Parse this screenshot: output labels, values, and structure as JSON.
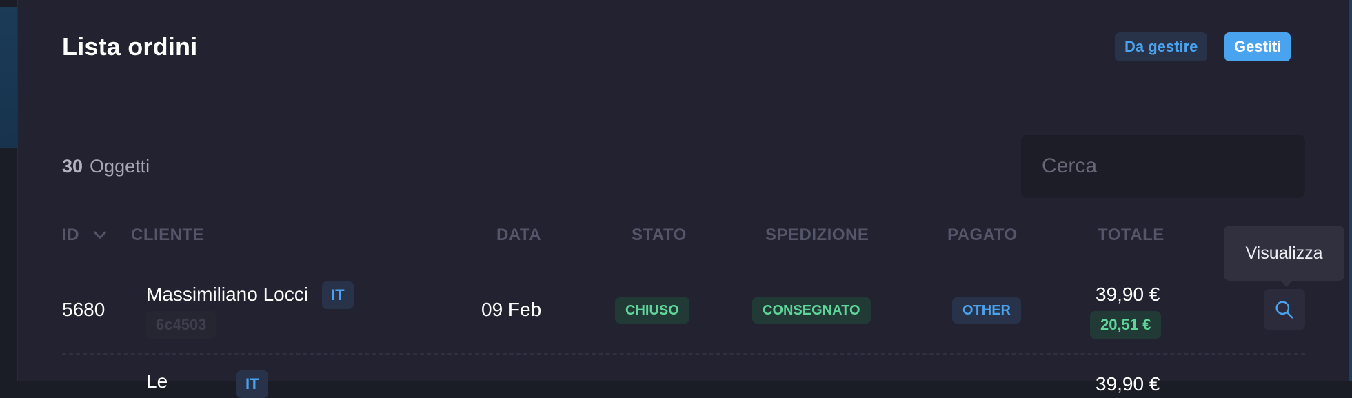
{
  "header": {
    "title": "Lista ordini",
    "filters": {
      "pending_label": "Da gestire",
      "done_label": "Gestiti"
    }
  },
  "toolbar": {
    "count": "30",
    "count_label": "Oggetti",
    "search_placeholder": "Cerca"
  },
  "table": {
    "columns": {
      "id": "ID",
      "cliente": "CLIENTE",
      "data": "DATA",
      "stato": "STATO",
      "spedizione": "SPEDIZIONE",
      "pagato": "PAGATO",
      "totale": "TOTALE"
    },
    "sort_icon": "chevron-down-icon",
    "rows": [
      {
        "id": "5680",
        "customer_name": "Massimiliano Locci",
        "customer_lang": "IT",
        "customer_ref": "6c4503",
        "date": "09 Feb",
        "status": "CHIUSO",
        "shipping": "CONSEGNATO",
        "payment": "OTHER",
        "total": "39,90 €",
        "net_total": "20,51 €",
        "action_icon": "search-icon"
      },
      {
        "customer_name_partial": "Le",
        "customer_lang": "IT",
        "total_partial": "39,90 €"
      }
    ]
  },
  "tooltip": {
    "text": "Visualizza"
  },
  "colors": {
    "background": "#1a1c26",
    "panel": "#222230",
    "accent_blue": "#4aa3ef",
    "accent_green": "#5fd59a",
    "muted_header": "#55556a"
  }
}
